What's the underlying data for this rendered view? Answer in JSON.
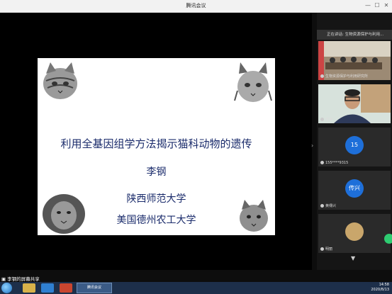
{
  "window": {
    "title": "腾讯会议"
  },
  "slide": {
    "title": "利用全基因组学方法揭示猫科动物的遗传",
    "author": "李钢",
    "affiliation_1": "陕西师范大学",
    "affiliation_2": "美国德州农工大学"
  },
  "panel": {
    "speaking": "正在讲话: 生物资源保护与利用...",
    "tiles": [
      {
        "label": "生物资源保护与利用研究所",
        "kind": "video-room"
      },
      {
        "label": "李钢",
        "kind": "video-person"
      },
      {
        "label": "155****9315",
        "avatar_text": "15",
        "avatar_color": "#1e6fd9"
      },
      {
        "label": "黄傳兴",
        "avatar_text": "传兴",
        "avatar_color": "#1e6fd9"
      },
      {
        "label": "明丽",
        "avatar_text": "",
        "avatar_color": "#c9a66b"
      }
    ]
  },
  "share_status": "李钢的屏幕共享",
  "taskbar": {
    "app_label": "腾讯会议",
    "time": "14:58",
    "date": "2020/8/13"
  }
}
